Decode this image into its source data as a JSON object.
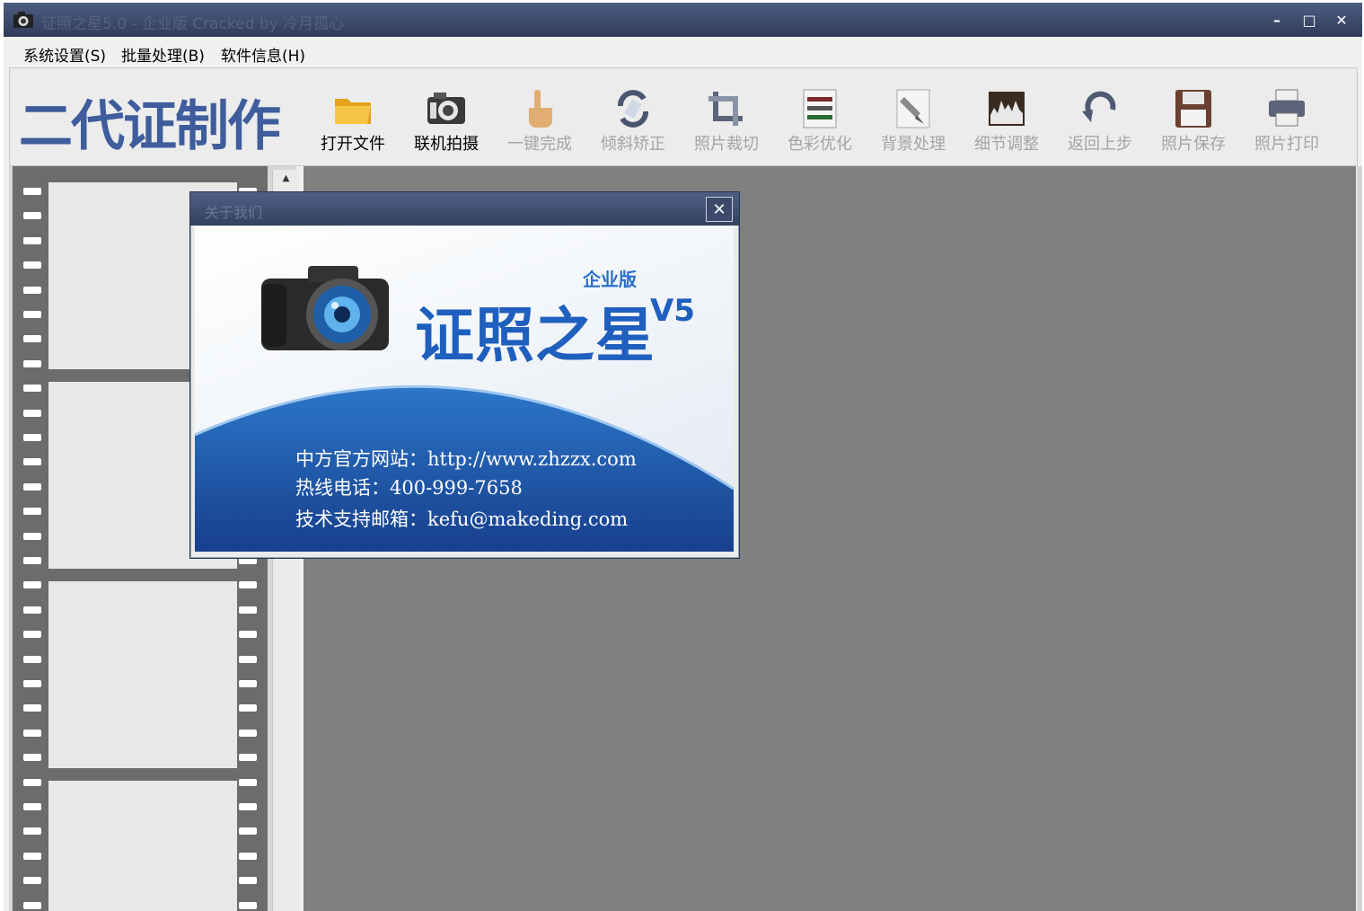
{
  "window": {
    "title": "证照之星5.0 - 企业版 Cracked by 冷月孤心",
    "controls": {
      "minimize": "–",
      "maximize": "□",
      "close": "✕"
    }
  },
  "menu": [
    {
      "label": "系统设置(S)"
    },
    {
      "label": "批量处理(B)"
    },
    {
      "label": "软件信息(H)"
    }
  ],
  "toolbar": {
    "logo": "二代证制作",
    "tools": [
      {
        "label": "打开文件",
        "icon": "folder-icon",
        "enabled": true
      },
      {
        "label": "联机拍摄",
        "icon": "camera-icon",
        "enabled": true
      },
      {
        "label": "一键完成",
        "icon": "hand-pointer-icon",
        "enabled": false
      },
      {
        "label": "倾斜矫正",
        "icon": "rotate-icon",
        "enabled": false
      },
      {
        "label": "照片裁切",
        "icon": "crop-icon",
        "enabled": false
      },
      {
        "label": "色彩优化",
        "icon": "color-sliders-icon",
        "enabled": false
      },
      {
        "label": "背景处理",
        "icon": "brush-icon",
        "enabled": false
      },
      {
        "label": "细节调整",
        "icon": "histogram-icon",
        "enabled": false
      },
      {
        "label": "返回上步",
        "icon": "undo-icon",
        "enabled": false
      },
      {
        "label": "照片保存",
        "icon": "floppy-disk-icon",
        "enabled": false
      },
      {
        "label": "照片打印",
        "icon": "printer-icon",
        "enabled": false
      }
    ]
  },
  "about_dialog": {
    "title": "关于我们",
    "close": "✕",
    "edition": "企业版",
    "product": "证照之星",
    "version": "V5",
    "website": "中方官方网站：http://www.zhzzx.com",
    "hotline": "热线电话：400-999-7658",
    "email": "技术支持邮箱：kefu@makeding.com"
  },
  "colors": {
    "titlebar": "#34415f",
    "canvas": "#808080",
    "brand_blue": "#1f5fbe",
    "logo_blue": "#3f5d9c",
    "disabled_text": "#a4a4a4"
  }
}
